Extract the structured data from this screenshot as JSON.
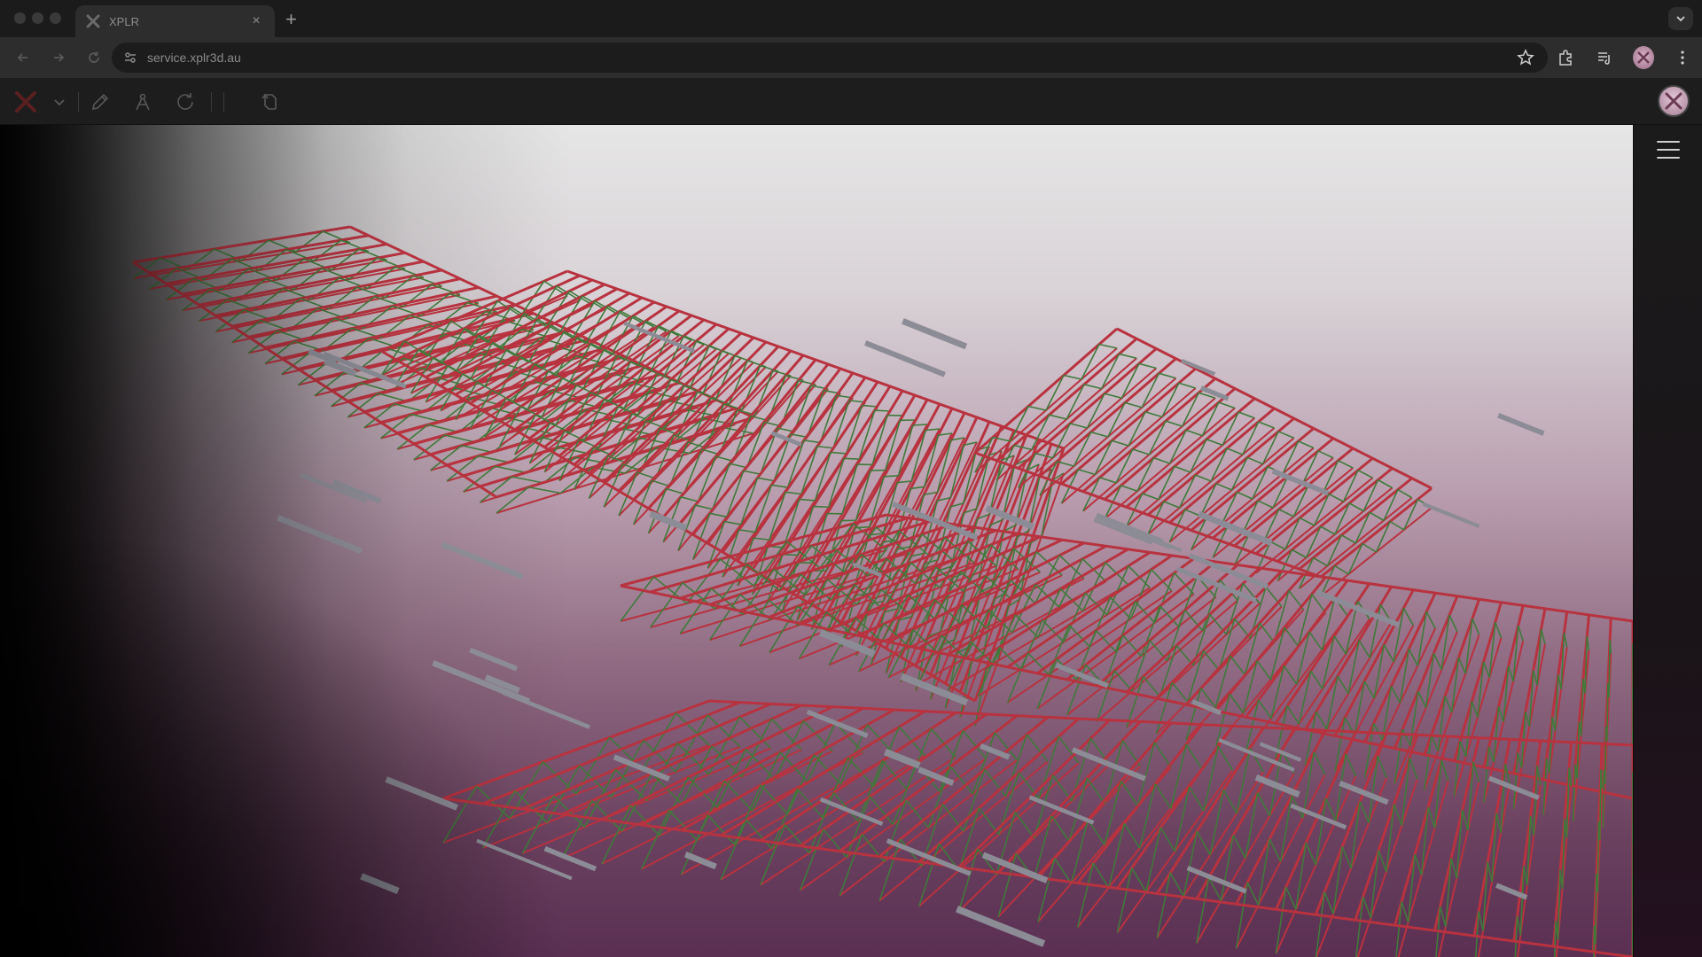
{
  "browser": {
    "tab_title": "XPLR",
    "url": "service.xplr3d.au",
    "new_tab_symbol": "+",
    "close_symbol": "×"
  },
  "icons": {
    "tab_favicon": "xplr-logo-icon",
    "back": "back-arrow-icon",
    "forward": "forward-arrow-icon",
    "reload": "reload-icon",
    "site_info": "site-info-icon",
    "bookmark": "star-icon",
    "extensions": "puzzle-icon",
    "media": "media-controls-icon",
    "profile": "profile-avatar",
    "menu": "kebab-menu-icon",
    "tab_search": "chevron-down-icon",
    "app_logo": "xplr-logo-icon",
    "pencil": "pencil-icon",
    "pin_tool": "compass-icon",
    "refresh_tool": "rotate-icon",
    "orbit_tool": "orbit-icon",
    "sidebar_menu": "hamburger-icon"
  },
  "colors": {
    "accent": "#d0312d",
    "truss_red": "#b8323f",
    "truss_green": "#3f7a3a",
    "duct_grey": "#8c8c96"
  }
}
